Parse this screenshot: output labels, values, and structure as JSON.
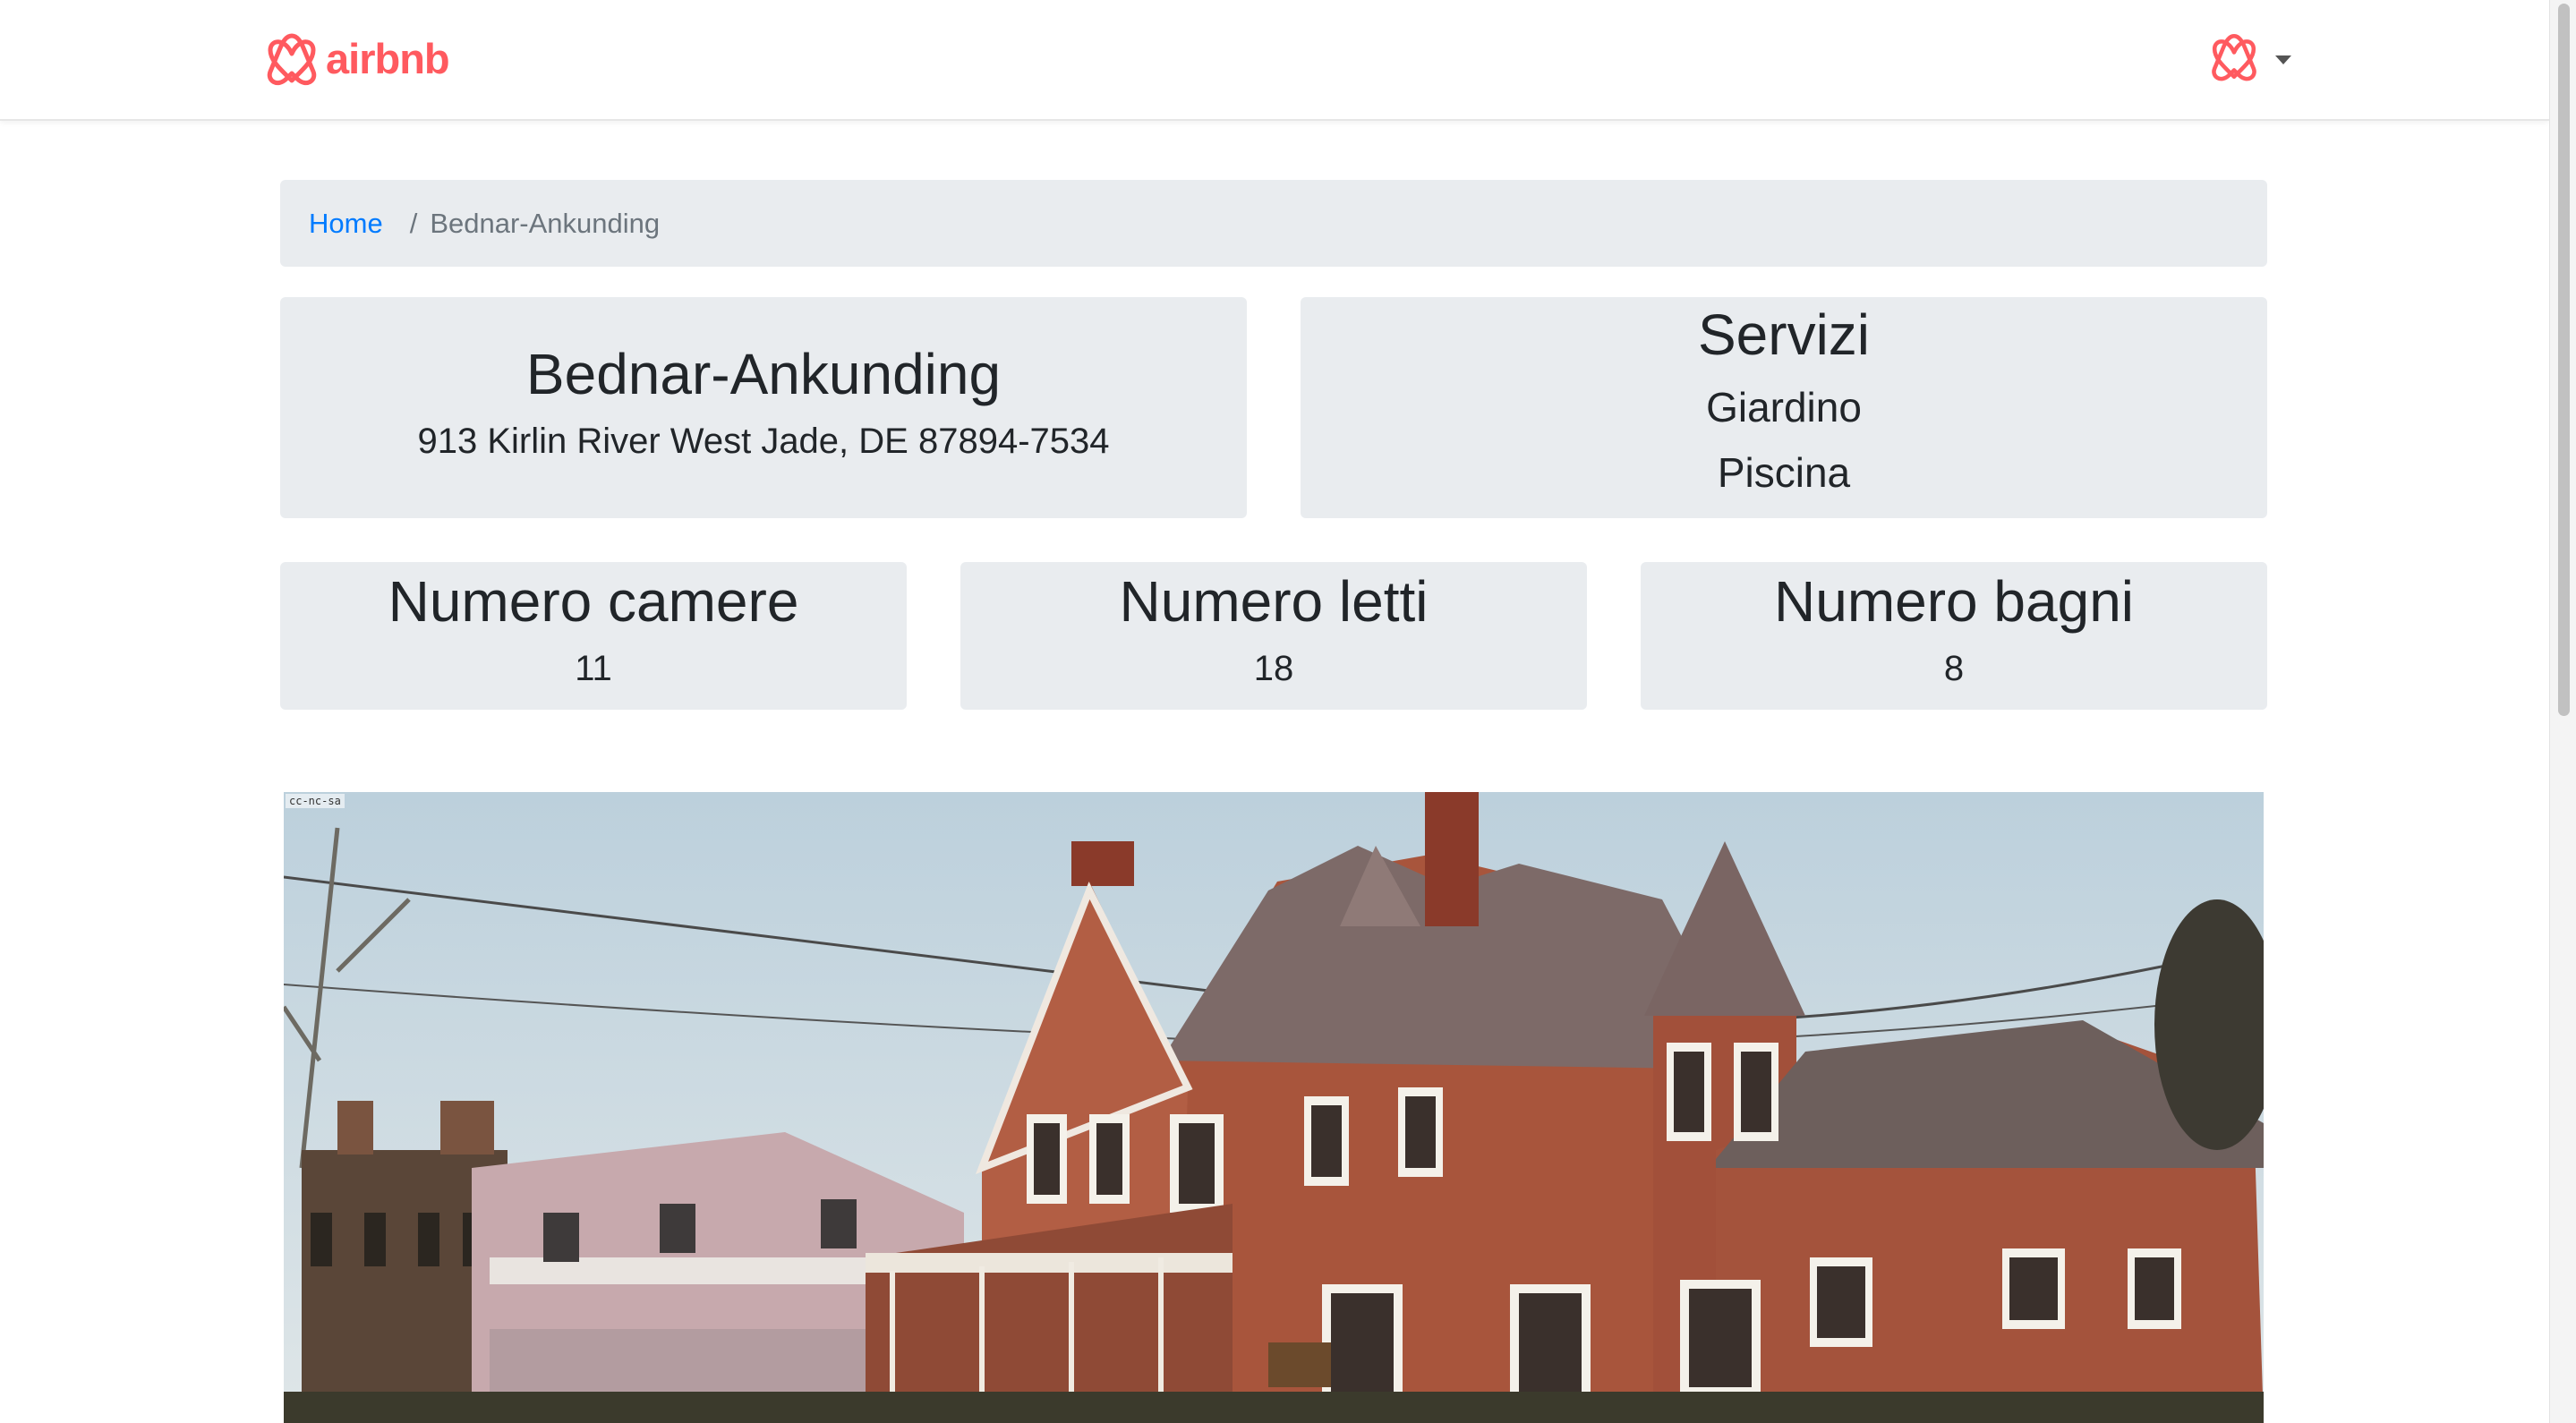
{
  "navbar": {
    "brand_name": "airbnb",
    "brand_color": "#ff5a5f"
  },
  "breadcrumb": {
    "home_label": "Home",
    "separator": "/",
    "current_label": "Bednar-Ankunding"
  },
  "property": {
    "name": "Bednar-Ankunding",
    "address": "913 Kirlin River West Jade, DE 87894-7534"
  },
  "services": {
    "title": "Servizi",
    "items": [
      "Giardino",
      "Piscina"
    ]
  },
  "stats": [
    {
      "label": "Numero camere",
      "value": "11"
    },
    {
      "label": "Numero letti",
      "value": "18"
    },
    {
      "label": "Numero bagni",
      "value": "8"
    }
  ],
  "photo": {
    "license_tag": "cc-nc-sa"
  },
  "colors": {
    "link": "#007bff",
    "panel_bg": "#e9ecef",
    "muted": "#6c757d"
  }
}
